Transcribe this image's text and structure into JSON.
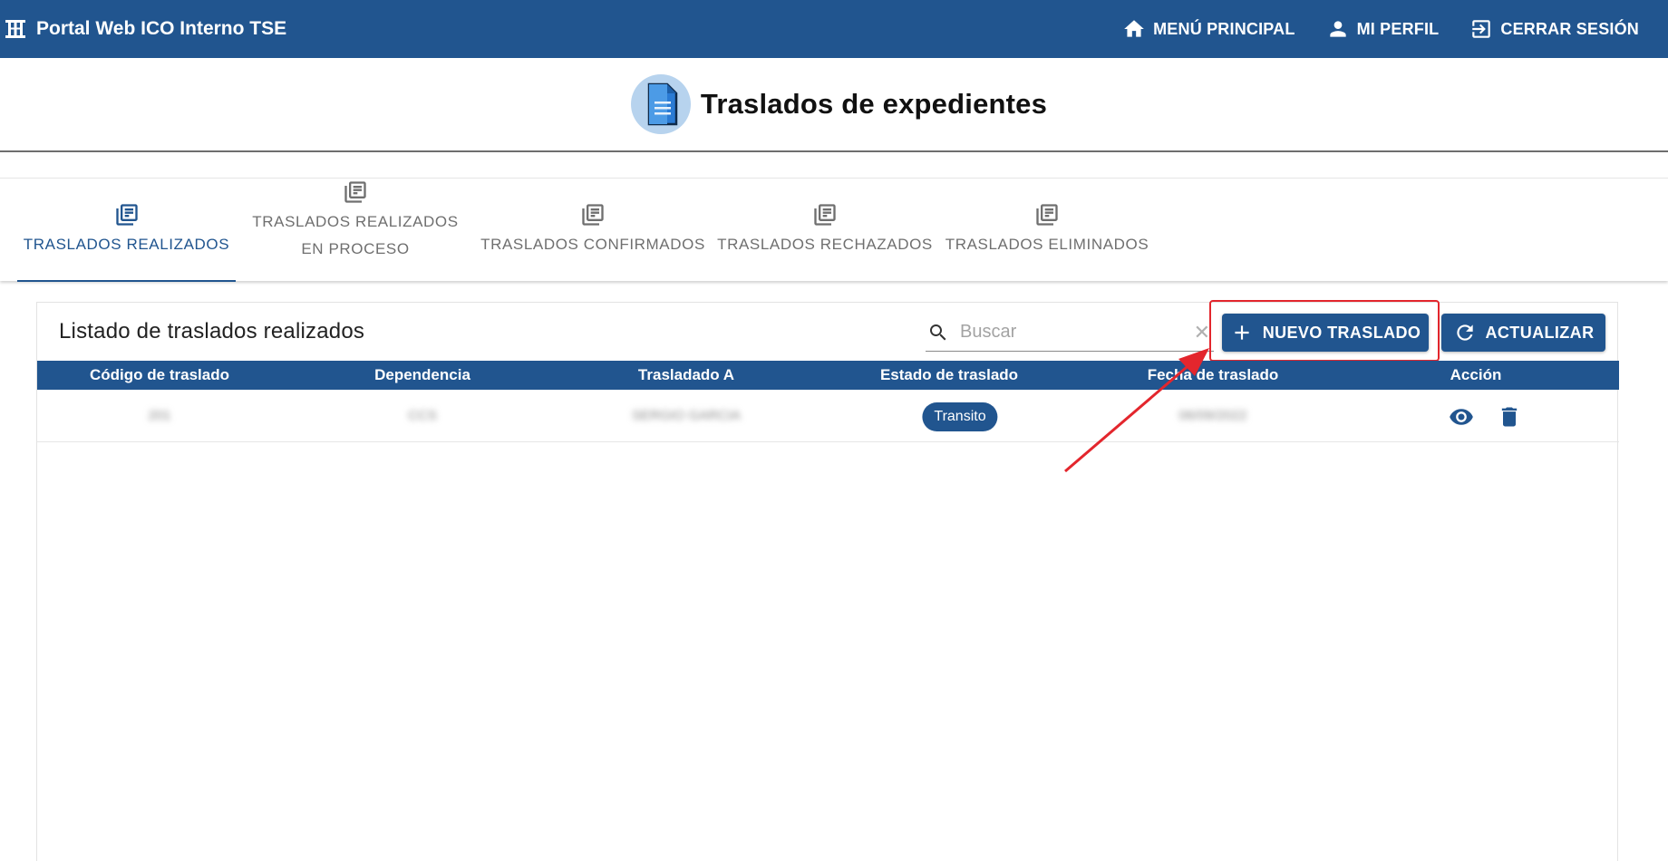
{
  "topbar": {
    "brand_title": "Portal Web ICO Interno TSE",
    "nav": {
      "menu_principal": "MENÚ PRINCIPAL",
      "mi_perfil": "MI PERFIL",
      "cerrar_sesion": "CERRAR SESIÓN"
    }
  },
  "page": {
    "title": "Traslados de expedientes"
  },
  "tabs": [
    {
      "label": "TRASLADOS REALIZADOS",
      "active": true
    },
    {
      "label_line1": "TRASLADOS REALIZADOS",
      "label_line2": "EN PROCESO",
      "active": false
    },
    {
      "label": "TRASLADOS CONFIRMADOS",
      "active": false
    },
    {
      "label": "TRASLADOS RECHAZADOS",
      "active": false
    },
    {
      "label": "TRASLADOS ELIMINADOS",
      "active": false
    }
  ],
  "list": {
    "title": "Listado de traslados realizados",
    "search": {
      "placeholder": "Buscar",
      "value": ""
    },
    "new_button": "NUEVO TRASLADO",
    "refresh_button": "ACTUALIZAR",
    "columns": [
      "Código de traslado",
      "Dependencia",
      "Trasladado A",
      "Estado de traslado",
      "Fecha de traslado",
      "Acción"
    ],
    "rows": [
      {
        "codigo": "201",
        "dependencia": "CCS",
        "trasladado_a": "SERGIO GARCIA",
        "estado": "Transito",
        "fecha": "06/09/2022"
      }
    ]
  },
  "colors": {
    "primary": "#21558f",
    "annotation": "#e3262d"
  }
}
